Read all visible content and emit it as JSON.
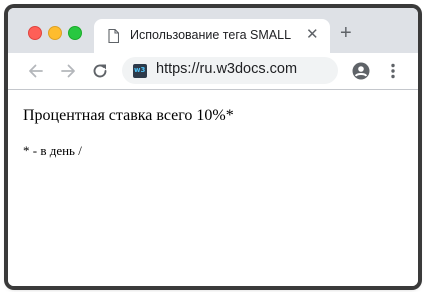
{
  "tab": {
    "title": "Использование тега SMALL",
    "close_glyph": "✕"
  },
  "new_tab_glyph": "+",
  "address_bar": {
    "url": "https://ru.w3docs.com",
    "site_icon_text": "w3"
  },
  "content": {
    "main_text": "Процентная ставка всего 10%*",
    "small_text": "* - в день /"
  },
  "colors": {
    "titlebar": "#dee1e6",
    "close": "#fe5f57",
    "minimize": "#febc2e",
    "maximize": "#28c840"
  }
}
